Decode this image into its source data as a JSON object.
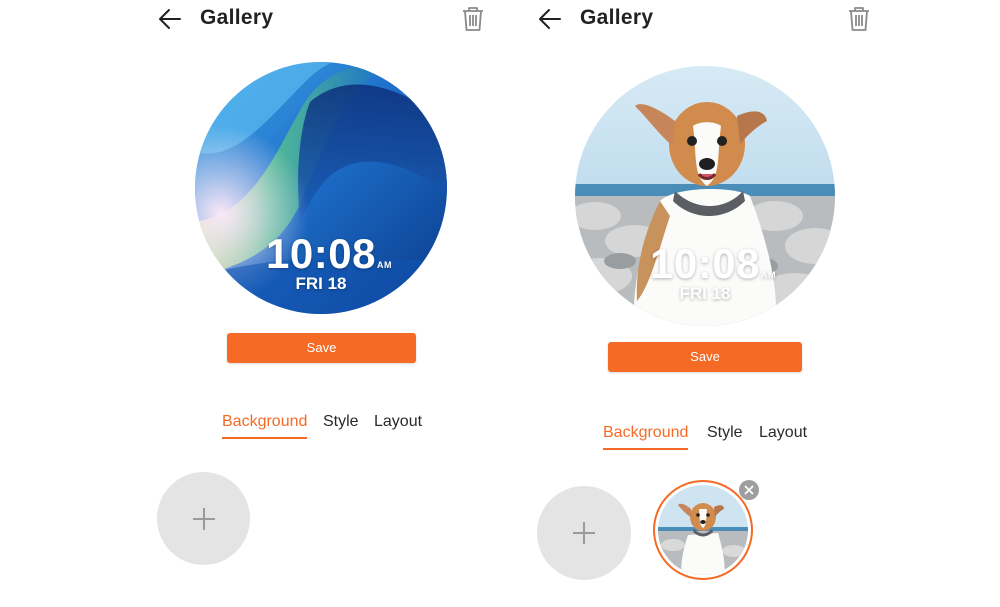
{
  "screens": [
    {
      "title": "Gallery",
      "watch": {
        "time": "10:08",
        "ampm": "AM",
        "date": "FRI 18",
        "background": "abstract-blue-wave"
      },
      "save_label": "Save",
      "tabs": [
        "Background",
        "Style",
        "Layout"
      ],
      "active_tab": "Background"
    },
    {
      "title": "Gallery",
      "watch": {
        "time": "10:08",
        "ampm": "AM",
        "date": "FRI 18",
        "background": "dog-photo"
      },
      "save_label": "Save",
      "tabs": [
        "Background",
        "Style",
        "Layout"
      ],
      "active_tab": "Background",
      "thumbnails": [
        {
          "image": "dog-photo",
          "selected": true
        }
      ]
    }
  ],
  "icons": {
    "back": "arrow-left-icon",
    "delete": "trash-icon",
    "add": "plus-icon",
    "remove": "close-icon"
  },
  "colors": {
    "accent": "#f56a24",
    "add_button_bg": "#e4e4e4",
    "text": "#222222"
  }
}
